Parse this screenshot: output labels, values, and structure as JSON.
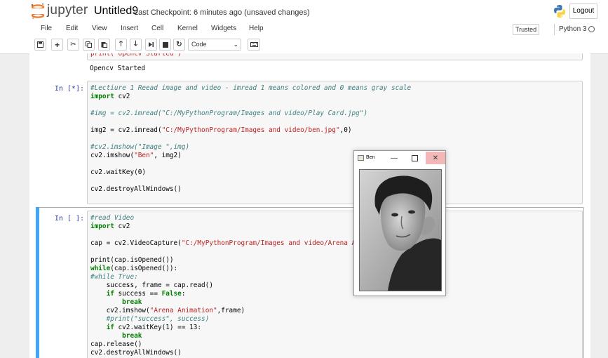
{
  "header": {
    "logo_text": "jupyter",
    "notebook_title": "Untitled9",
    "checkpoint": "Last Checkpoint: 6 minutes ago (unsaved changes)",
    "logout_label": "Logout"
  },
  "menubar": {
    "items": [
      "File",
      "Edit",
      "View",
      "Insert",
      "Cell",
      "Kernel",
      "Widgets",
      "Help"
    ],
    "trusted_label": "Trusted",
    "kernel_name": "Python 3"
  },
  "toolbar": {
    "icons": [
      "save-icon",
      "add-cell-icon",
      "cut-icon",
      "copy-icon",
      "paste-icon",
      "move-up-icon",
      "move-down-icon",
      "run-icon",
      "stop-icon",
      "restart-icon",
      "keyboard-icon"
    ],
    "cell_type": "Code"
  },
  "cells": [
    {
      "output": "Opencv Started",
      "code": [
        [
          [
            "string",
            "print(\"Opencv Started\")"
          ]
        ]
      ]
    },
    {
      "prompt": "In [*]:",
      "code": [
        [
          [
            "comment",
            "#Lectiure 1 Reead image and video - imread 1 means colored and 0 means gray scale"
          ]
        ],
        [
          [
            "keyword",
            "import"
          ],
          [
            "plain",
            " cv2"
          ]
        ],
        [],
        [
          [
            "comment",
            "#img = cv2.imread(\"C:/MyPythonProgram/Images and video/Play Card.jpg\")"
          ]
        ],
        [],
        [
          [
            "plain",
            "img2 = cv2.imread("
          ],
          [
            "string",
            "\"C:/MyPythonProgram/Images and video/ben.jpg\""
          ],
          [
            "plain",
            ",0)"
          ]
        ],
        [],
        [
          [
            "comment",
            "#cv2.imshow(\"Image \",img)"
          ]
        ],
        [
          [
            "plain",
            "cv2.imshow("
          ],
          [
            "string",
            "\"Ben\""
          ],
          [
            "plain",
            ", img2)"
          ]
        ],
        [],
        [
          [
            "plain",
            "cv2.waitKey(0)"
          ]
        ],
        [],
        [
          [
            "plain",
            "cv2.destroyAllWindows()"
          ]
        ]
      ]
    },
    {
      "prompt": "In [ ]:",
      "code": [
        [
          [
            "comment",
            "#read Video"
          ]
        ],
        [
          [
            "keyword",
            "import"
          ],
          [
            "plain",
            " cv2"
          ]
        ],
        [],
        [
          [
            "plain",
            "cap = cv2.VideoCapture("
          ],
          [
            "string",
            "\"C:/MyPythonProgram/Images and video/Arena Ani"
          ]
        ],
        [],
        [
          [
            "plain",
            "print(cap.isOpened())"
          ]
        ],
        [
          [
            "keyword",
            "while"
          ],
          [
            "plain",
            "(cap.isOpened()):"
          ]
        ],
        [
          [
            "comment",
            "#while True:"
          ]
        ],
        [
          [
            "plain",
            "    success, frame = cap.read()"
          ]
        ],
        [
          [
            "plain",
            "    "
          ],
          [
            "keyword",
            "if"
          ],
          [
            "plain",
            " success == "
          ],
          [
            "keyword",
            "False"
          ],
          [
            "plain",
            ":"
          ]
        ],
        [
          [
            "plain",
            "        "
          ],
          [
            "keyword",
            "break"
          ]
        ],
        [
          [
            "plain",
            "    cv2.imshow("
          ],
          [
            "string",
            "\"Arena Animation\""
          ],
          [
            "plain",
            ",frame)"
          ]
        ],
        [
          [
            "plain",
            "    "
          ],
          [
            "comment",
            "#print(\"success\", success)"
          ]
        ],
        [
          [
            "plain",
            "    "
          ],
          [
            "keyword",
            "if"
          ],
          [
            "plain",
            " cv2.waitKey(1) == 13:"
          ]
        ],
        [
          [
            "plain",
            "        "
          ],
          [
            "keyword",
            "break"
          ]
        ],
        [
          [
            "plain",
            "cap.release()"
          ]
        ],
        [
          [
            "plain",
            "cv2.destroyAllWindows()"
          ]
        ]
      ]
    }
  ],
  "popup": {
    "title": "Ben"
  }
}
